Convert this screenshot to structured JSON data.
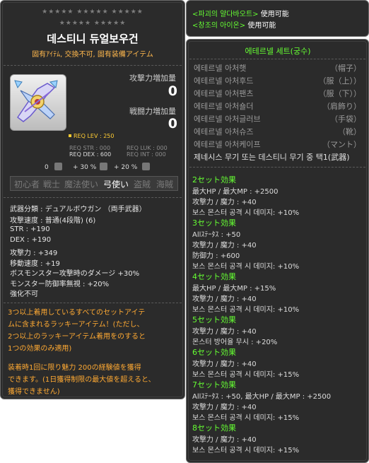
{
  "left": {
    "stars_row1": "★★★★★ ★★★★★ ★★★★★",
    "stars_row2": "★★★★★ ★★★★★",
    "title": "데스티니 듀얼보우건",
    "subtitle": "固有ｱｲﾃﾑ, 交換不可, 固有装備アイテム",
    "attack_label": "攻撃力増加量",
    "attack_value": "0",
    "combat_label": "戦闘力増加量",
    "combat_value": "0",
    "req_lev": "REQ LEV : 250",
    "req_str": "REQ STR : 000",
    "req_luk": "REQ LUK : 000",
    "req_dex": "REQ DEX : 600",
    "req_int": "REQ INT : 000",
    "upg_1": "0",
    "upg_2": "+ 30 %",
    "upg_3": "+ 20 %",
    "jobs": [
      "初心者",
      "戦士",
      "魔法使い",
      "弓使い",
      "盗賊",
      "海賊"
    ],
    "options": [
      "武器分類 : デュアルボウガン （両手武器）",
      "攻撃速度 : 普通(4段階) (6)",
      "STR : +190",
      "DEX : +190",
      "攻撃力 : +349",
      "移動速度 : +19",
      "ボスモンスター攻撃時のダメージ +30%",
      "モンスター防御率無視 : +20%",
      "強化不可"
    ],
    "desc1": [
      "3つ以上着用しているすべてのセットアイテ",
      "ムに含まれるラッキーアイテム！(ただし、",
      "2つ以上のラッキーアイテム着用をのすると",
      "1つの効果のみ適用)"
    ],
    "desc2": [
      "装着時1回に限り魅力 200の経験値を獲得",
      "できます。(1日獲得制限の最大値を超えると、",
      "獲得できません)"
    ]
  },
  "right_top": {
    "line1_name": "<파괴의 얄다바오트>",
    "line1_suffix": "使用可能",
    "line2_name": "<창조의 아이온>",
    "line2_suffix": "使用可能"
  },
  "set": {
    "title": "에테르넬 세트(궁수)",
    "items": [
      {
        "name": "에테르넬 아처햇",
        "slot": "（帽子）"
      },
      {
        "name": "에테르넬 아처후드",
        "slot": "（服（上））"
      },
      {
        "name": "에테르넬 아처팬츠",
        "slot": "（服（下））"
      },
      {
        "name": "에테르넬 아처숄더",
        "slot": "（肩飾り）"
      },
      {
        "name": "에테르넬 아처글러브",
        "slot": "（手袋）"
      },
      {
        "name": "에테르넬 아처슈즈",
        "slot": "（靴）"
      },
      {
        "name": "에테르넬 아처케이프",
        "slot": "（マント）"
      }
    ],
    "last_item": "제네시스 무기 또는 데스티니 무기 중 택1(武器)",
    "bonuses": [
      {
        "title": "2セット効果",
        "lines": [
          "最大HP / 最大MP : +2500",
          "攻撃力 / 魔力 : +40",
          "보스 몬스터 공격 시 데미지: +10%"
        ]
      },
      {
        "title": "3セット効果",
        "lines": [
          "Allｽﾃｰﾀｽ : +50",
          "攻撃力 / 魔力 : +40",
          "防御力 : +600",
          "보스 몬스터 공격 시 데미지: +10%"
        ]
      },
      {
        "title": "4セット効果",
        "lines": [
          "最大HP / 最大MP : +15%",
          "攻撃力 / 魔力 : +40",
          "보스 몬스터 공격 시 데미지: +10%"
        ]
      },
      {
        "title": "5セット効果",
        "lines": [
          "攻撃力 / 魔力 : +40",
          "몬스터 방어율 무시 : +20%"
        ]
      },
      {
        "title": "6セット効果",
        "lines": [
          "攻撃力 / 魔力 : +40",
          "보스 몬스터 공격 시 데미지: +15%"
        ]
      },
      {
        "title": "7セット効果",
        "lines": [
          "Allｽﾃｰﾀｽ : +50, 最大HP / 最大MP : +2500",
          "攻撃力 / 魔力 : +40",
          "보스 몬스터 공격 시 데미지: +15%"
        ]
      },
      {
        "title": "8セット効果",
        "lines": [
          "攻撃力 / 魔力 : +40",
          "보스 몬스터 공격 시 데미지: +15%"
        ]
      }
    ]
  },
  "colors": {
    "panel": "#2b2b2b",
    "green": "#66ff33",
    "orange": "#ffaa33",
    "yellow": "#ffcc33"
  }
}
